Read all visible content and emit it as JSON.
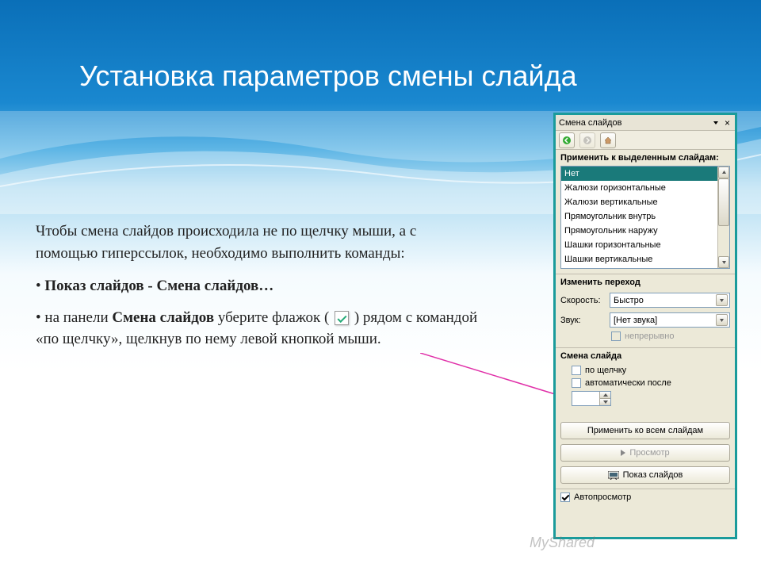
{
  "title": "Установка параметров смены слайда",
  "body": {
    "p1": "Чтобы смена слайдов происходила не по щелчку мыши, а с помощью гиперссылок, необходимо выполнить команды:",
    "b1": "Показ слайдов - Смена слайдов…",
    "b2a": "на панели ",
    "b2b": "Смена слайдов",
    "b2c": " уберите флажок ( ",
    "b2d": " ) рядом с командой «по щелчку», щелкнув по нему левой кнопкой мыши."
  },
  "panel": {
    "title": "Смена слайдов",
    "section_apply": "Применить к выделенным слайдам:",
    "transitions": [
      "Нет",
      "Жалюзи горизонтальные",
      "Жалюзи вертикальные",
      "Прямоугольник внутрь",
      "Прямоугольник наружу",
      "Шашки горизонтальные",
      "Шашки вертикальные"
    ],
    "section_modify": "Изменить переход",
    "speed_label": "Скорость:",
    "speed_value": "Быстро",
    "sound_label": "Звук:",
    "sound_value": "[Нет звука]",
    "loop_label": "непрерывно",
    "section_advance": "Смена слайда",
    "onclick_label": "по щелчку",
    "after_label": "автоматически после",
    "time_value": "",
    "apply_all": "Применить ко всем слайдам",
    "preview": "Просмотр",
    "slideshow": "Показ слайдов",
    "autopreview": "Автопросмотр"
  }
}
